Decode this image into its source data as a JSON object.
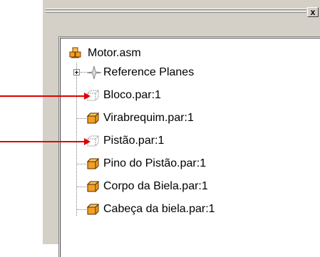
{
  "window": {
    "close_glyph": "x"
  },
  "tree": {
    "root": {
      "label": "Motor.asm",
      "icon": "assembly-icon"
    },
    "items": [
      {
        "label": "Reference Planes",
        "icon": "reference-planes-icon",
        "expandable": true
      },
      {
        "label": "Bloco.par:1",
        "icon": "part-hidden-icon",
        "hidden": true
      },
      {
        "label": "Virabrequim.par:1",
        "icon": "part-icon"
      },
      {
        "label": "Pistão.par:1",
        "icon": "part-hidden-icon",
        "hidden": true
      },
      {
        "label": "Pino do Pistão.par:1",
        "icon": "part-icon"
      },
      {
        "label": "Corpo da Biela.par:1",
        "icon": "part-icon"
      },
      {
        "label": "Cabeça da biela.par:1",
        "icon": "part-icon"
      }
    ]
  },
  "annotations": {
    "arrow_color": "#e00000"
  }
}
